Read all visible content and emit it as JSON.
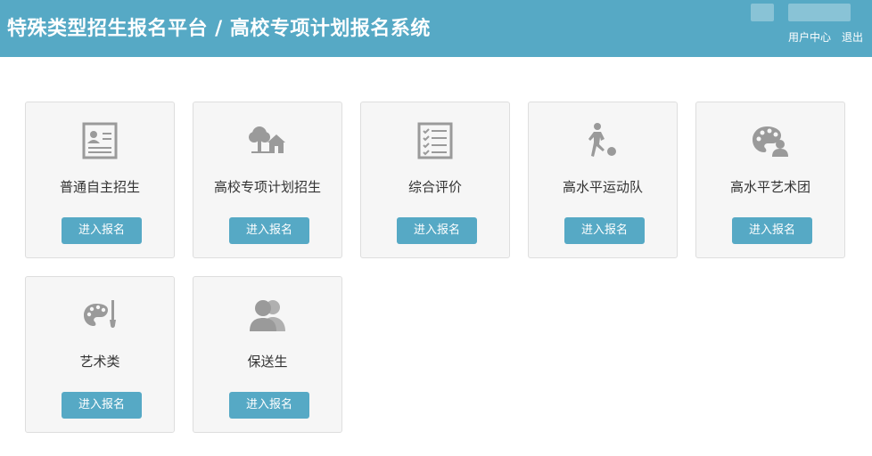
{
  "header": {
    "title": "特殊类型招生报名平台 / 高校专项计划报名系统",
    "user_center": "用户中心",
    "logout": "退出",
    "background": "#56a9c5"
  },
  "cards": [
    {
      "label": "普通自主招生",
      "icon": "profile-card-icon",
      "button": "进入报名"
    },
    {
      "label": "高校专项计划招生",
      "icon": "tree-house-icon",
      "button": "进入报名"
    },
    {
      "label": "综合评价",
      "icon": "checklist-icon",
      "button": "进入报名"
    },
    {
      "label": "高水平运动队",
      "icon": "soccer-player-icon",
      "button": "进入报名"
    },
    {
      "label": "高水平艺术团",
      "icon": "palette-person-icon",
      "button": "进入报名"
    },
    {
      "label": "艺术类",
      "icon": "palette-brush-icon",
      "button": "进入报名"
    },
    {
      "label": "保送生",
      "icon": "people-icon",
      "button": "进入报名"
    }
  ],
  "colors": {
    "accent": "#56a9c5",
    "icon": "#9a9a9a",
    "card_bg": "#f6f6f6"
  }
}
